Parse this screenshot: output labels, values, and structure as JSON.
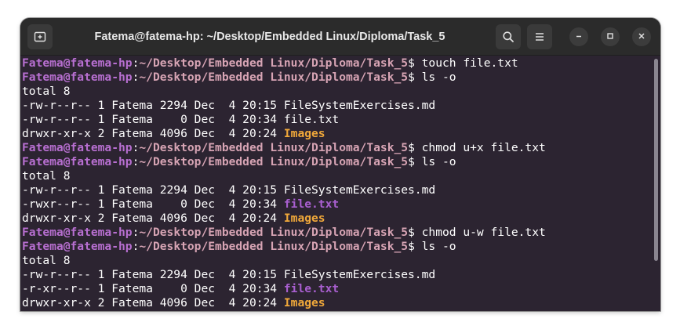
{
  "window": {
    "title": "Fatema@fatema-hp: ~/Desktop/Embedded Linux/Diploma/Task_5"
  },
  "icons": {
    "new_tab": "new-tab-icon",
    "search": "search-icon",
    "menu": "hamburger-menu-icon",
    "minimize": "minimize-icon",
    "maximize": "maximize-icon",
    "close": "close-icon"
  },
  "colors": {
    "terminal_bg": "#2c2431",
    "prompt_user": "#b86fd1",
    "prompt_path": "#d7a4b4",
    "directory": "#f0a83a",
    "executable": "#a95fd0"
  },
  "prompt": {
    "user": "Fatema@fatema-hp",
    "colon": ":",
    "path": "~/Desktop/Embedded Linux/Diploma/Task_5",
    "symbol": "$ "
  },
  "lines": [
    {
      "type": "cmd",
      "text": "touch file.txt"
    },
    {
      "type": "cmd",
      "text": "ls -o"
    },
    {
      "type": "out",
      "text": "total 8"
    },
    {
      "type": "out",
      "text": "-rw-r--r-- 1 Fatema 2294 Dec  4 20:15 FileSystemExercises.md"
    },
    {
      "type": "out",
      "text": "-rw-r--r-- 1 Fatema    0 Dec  4 20:34 file.txt"
    },
    {
      "type": "file",
      "meta": "drwxr-xr-x 2 Fatema 4096 Dec  4 20:24 ",
      "name": "Images",
      "style": "dir"
    },
    {
      "type": "cmd",
      "text": "chmod u+x file.txt"
    },
    {
      "type": "cmd",
      "text": "ls -o"
    },
    {
      "type": "out",
      "text": "total 8"
    },
    {
      "type": "out",
      "text": "-rw-r--r-- 1 Fatema 2294 Dec  4 20:15 FileSystemExercises.md"
    },
    {
      "type": "file",
      "meta": "-rwxr--r-- 1 Fatema    0 Dec  4 20:34 ",
      "name": "file.txt",
      "style": "exec"
    },
    {
      "type": "file",
      "meta": "drwxr-xr-x 2 Fatema 4096 Dec  4 20:24 ",
      "name": "Images",
      "style": "dir"
    },
    {
      "type": "cmd",
      "text": "chmod u-w file.txt"
    },
    {
      "type": "cmd",
      "text": "ls -o"
    },
    {
      "type": "out",
      "text": "total 8"
    },
    {
      "type": "out",
      "text": "-rw-r--r-- 1 Fatema 2294 Dec  4 20:15 FileSystemExercises.md"
    },
    {
      "type": "file",
      "meta": "-r-xr--r-- 1 Fatema    0 Dec  4 20:34 ",
      "name": "file.txt",
      "style": "exec"
    },
    {
      "type": "file",
      "meta": "drwxr-xr-x 2 Fatema 4096 Dec  4 20:24 ",
      "name": "Images",
      "style": "dir"
    }
  ]
}
